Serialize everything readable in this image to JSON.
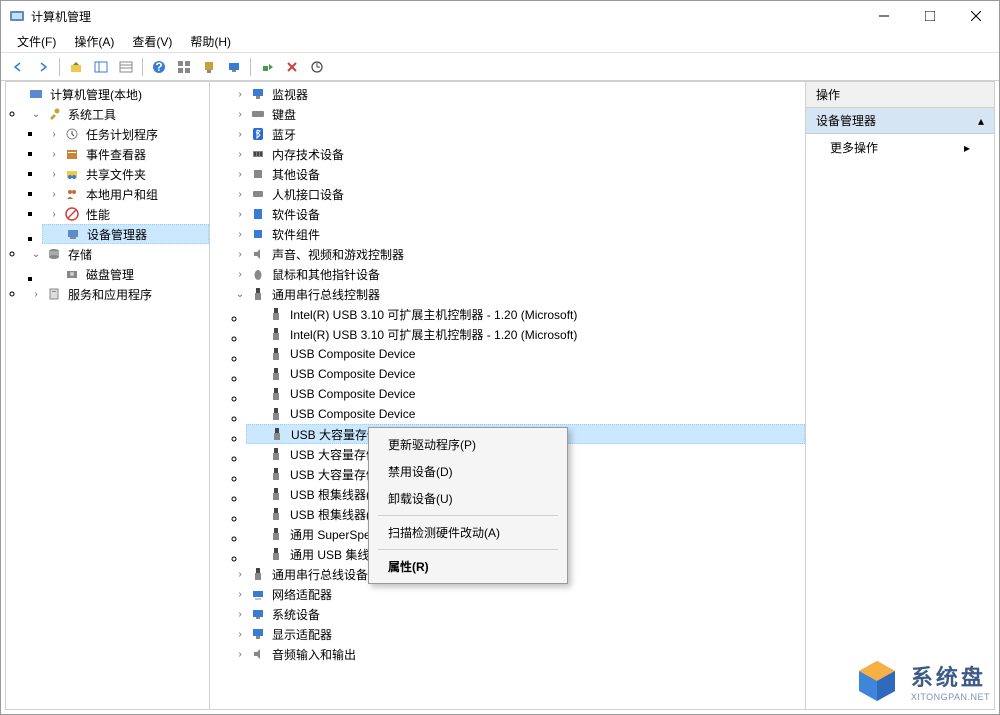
{
  "window": {
    "title": "计算机管理"
  },
  "menu": {
    "file": "文件(F)",
    "action": "操作(A)",
    "view": "查看(V)",
    "help": "帮助(H)"
  },
  "left_tree": {
    "root": "计算机管理(本地)",
    "system_tools": "系统工具",
    "task_scheduler": "任务计划程序",
    "event_viewer": "事件查看器",
    "shared_folders": "共享文件夹",
    "local_users": "本地用户和组",
    "performance": "性能",
    "device_manager": "设备管理器",
    "storage": "存储",
    "disk_management": "磁盘管理",
    "services_apps": "服务和应用程序"
  },
  "mid_tree": {
    "monitor": "监视器",
    "keyboard": "键盘",
    "bluetooth": "蓝牙",
    "memory": "内存技术设备",
    "other": "其他设备",
    "hid": "人机接口设备",
    "software_dev": "软件设备",
    "software_comp": "软件组件",
    "sound": "声音、视频和游戏控制器",
    "mouse": "鼠标和其他指针设备",
    "usb_controllers": "通用串行总线控制器",
    "usb_intel1": "Intel(R) USB 3.10 可扩展主机控制器 - 1.20 (Microsoft)",
    "usb_intel2": "Intel(R) USB 3.10 可扩展主机控制器 - 1.20 (Microsoft)",
    "usb_comp1": "USB Composite Device",
    "usb_comp2": "USB Composite Device",
    "usb_comp3": "USB Composite Device",
    "usb_comp4": "USB Composite Device",
    "usb_mass1": "USB 大容量存储",
    "usb_mass2": "USB 大容量存储",
    "usb_mass3": "USB 大容量存储",
    "usb_root1": "USB 根集线器(",
    "usb_root2": "USB 根集线器(",
    "usb_super": "通用 SuperSpe",
    "usb_hub": "通用 USB 集线",
    "usb_bus_dev": "通用串行总线设备",
    "network": "网络适配器",
    "system_dev": "系统设备",
    "display": "显示适配器",
    "audio_io": "音频输入和输出"
  },
  "context_menu": {
    "update_driver": "更新驱动程序(P)",
    "disable": "禁用设备(D)",
    "uninstall": "卸载设备(U)",
    "scan": "扫描检测硬件改动(A)",
    "properties": "属性(R)"
  },
  "right": {
    "header": "操作",
    "section": "设备管理器",
    "more": "更多操作"
  },
  "watermark": {
    "cn": "系统盘",
    "en": "XITONGPAN.NET"
  }
}
